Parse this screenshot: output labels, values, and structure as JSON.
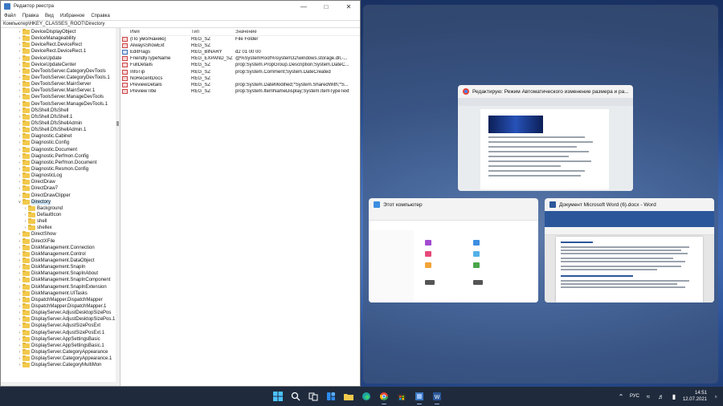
{
  "regedit": {
    "title": "Редактор реестра",
    "menu": [
      "Файл",
      "Правка",
      "Вид",
      "Избранное",
      "Справка"
    ],
    "address": "Компьютер\\HKEY_CLASSES_ROOT\\Directory",
    "tree": [
      {
        "label": "DeviceDisplayObject",
        "level": 0
      },
      {
        "label": "DeviceManageability",
        "level": 0
      },
      {
        "label": "DeviceRect.DeviceRect",
        "level": 0
      },
      {
        "label": "DeviceRect.DeviceRect.1",
        "level": 0
      },
      {
        "label": "DeviceUpdate",
        "level": 0
      },
      {
        "label": "DeviceUpdateCenter",
        "level": 0
      },
      {
        "label": "DevToolsServer.CategoryDevTools",
        "level": 0
      },
      {
        "label": "DevToolsServer.CategoryDevTools.1",
        "level": 0
      },
      {
        "label": "DevToolsServer.MainServer",
        "level": 0
      },
      {
        "label": "DevToolsServer.MainServer.1",
        "level": 0
      },
      {
        "label": "DevToolsServer.ManageDevTools",
        "level": 0
      },
      {
        "label": "DevToolsServer.ManageDevTools.1",
        "level": 0
      },
      {
        "label": "DfsShell.DfsShell",
        "level": 0
      },
      {
        "label": "DfsShell.DfsShell.1",
        "level": 0
      },
      {
        "label": "DfsShell.DfsShellAdmin",
        "level": 0
      },
      {
        "label": "DfsShell.DfsShellAdmin.1",
        "level": 0
      },
      {
        "label": "Diagnostic.Cabinet",
        "level": 0
      },
      {
        "label": "Diagnostic.Config",
        "level": 0
      },
      {
        "label": "Diagnostic.Document",
        "level": 0
      },
      {
        "label": "Diagnostic.Perfmon.Config",
        "level": 0
      },
      {
        "label": "Diagnostic.Perfmon.Document",
        "level": 0
      },
      {
        "label": "Diagnostic.Resmon.Config",
        "level": 0
      },
      {
        "label": "DiagnosticLog",
        "level": 0
      },
      {
        "label": "DirectDraw",
        "level": 0
      },
      {
        "label": "DirectDraw7",
        "level": 0
      },
      {
        "label": "DirectDrawClipper",
        "level": 0
      },
      {
        "label": "Directory",
        "level": 0,
        "expanded": true,
        "selected": true
      },
      {
        "label": "Background",
        "level": 1
      },
      {
        "label": "DefaultIcon",
        "level": 1
      },
      {
        "label": "shell",
        "level": 1
      },
      {
        "label": "shellex",
        "level": 1
      },
      {
        "label": "DirectShow",
        "level": 0
      },
      {
        "label": "DirectXFile",
        "level": 0
      },
      {
        "label": "DiskManagement.Connection",
        "level": 0
      },
      {
        "label": "DiskManagement.Control",
        "level": 0
      },
      {
        "label": "DiskManagement.DataObject",
        "level": 0
      },
      {
        "label": "DiskManagement.SnapIn",
        "level": 0
      },
      {
        "label": "DiskManagement.SnapInAbout",
        "level": 0
      },
      {
        "label": "DiskManagement.SnapInComponent",
        "level": 0
      },
      {
        "label": "DiskManagement.SnapInExtension",
        "level": 0
      },
      {
        "label": "DiskManagement.UITasks",
        "level": 0
      },
      {
        "label": "DispatchMapper.DispatchMapper",
        "level": 0
      },
      {
        "label": "DispatchMapper.DispatchMapper.1",
        "level": 0
      },
      {
        "label": "DisplayServer.AdjustDesktopSizePos",
        "level": 0
      },
      {
        "label": "DisplayServer.AdjustDesktopSizePos.1",
        "level": 0
      },
      {
        "label": "DisplayServer.AdjustSizePosExt",
        "level": 0
      },
      {
        "label": "DisplayServer.AdjustSizePosExt.1",
        "level": 0
      },
      {
        "label": "DisplayServer.AppSettingsBasic",
        "level": 0
      },
      {
        "label": "DisplayServer.AppSettingsBasic.1",
        "level": 0
      },
      {
        "label": "DisplayServer.CategoryAppearance",
        "level": 0
      },
      {
        "label": "DisplayServer.CategoryAppearance.1",
        "level": 0
      },
      {
        "label": "DisplayServer.CategoryMultiMon",
        "level": 0
      }
    ],
    "columns": {
      "name": "Имя",
      "type": "Тип",
      "data": "Значение"
    },
    "values": [
      {
        "name": "(По умолчанию)",
        "type": "REG_SZ",
        "data": "File Folder",
        "icon": "ab"
      },
      {
        "name": "AlwaysShowExt",
        "type": "REG_SZ",
        "data": "",
        "icon": "ab"
      },
      {
        "name": "EditFlags",
        "type": "REG_BINARY",
        "data": "d2 01 00 00",
        "icon": "bin"
      },
      {
        "name": "FriendlyTypeName",
        "type": "REG_EXPAND_SZ",
        "data": "@%SystemRoot%\\system32\\windows.storage.dll,-...",
        "icon": "ab"
      },
      {
        "name": "FullDetails",
        "type": "REG_SZ",
        "data": "prop:System.PropGroup.Description;System.DateC...",
        "icon": "ab"
      },
      {
        "name": "InfoTip",
        "type": "REG_SZ",
        "data": "prop:System.Comment;System.DateCreated",
        "icon": "ab"
      },
      {
        "name": "NoRecentDocs",
        "type": "REG_SZ",
        "data": "",
        "icon": "ab"
      },
      {
        "name": "PreviewDetails",
        "type": "REG_SZ",
        "data": "prop:System.DateModified;*System.SharedWith;*S...",
        "icon": "ab"
      },
      {
        "name": "PreviewTitle",
        "type": "REG_SZ",
        "data": "prop:System.ItemNameDisplay;System.ItemTypeText",
        "icon": "ab"
      }
    ]
  },
  "snap_cards": [
    {
      "title": "Редактирую: Режим Автоматического изменение размера и ра...",
      "icon_color": "#4285f4"
    },
    {
      "title": "Этот компьютер",
      "icon_color": "#3c8ee0"
    },
    {
      "title": "Документ Microsoft Word (6).docx - Word",
      "icon_color": "#2b579a"
    }
  ],
  "taskbar": {
    "lang": "РУС",
    "time": "14:51",
    "date": "12.07.2021"
  }
}
